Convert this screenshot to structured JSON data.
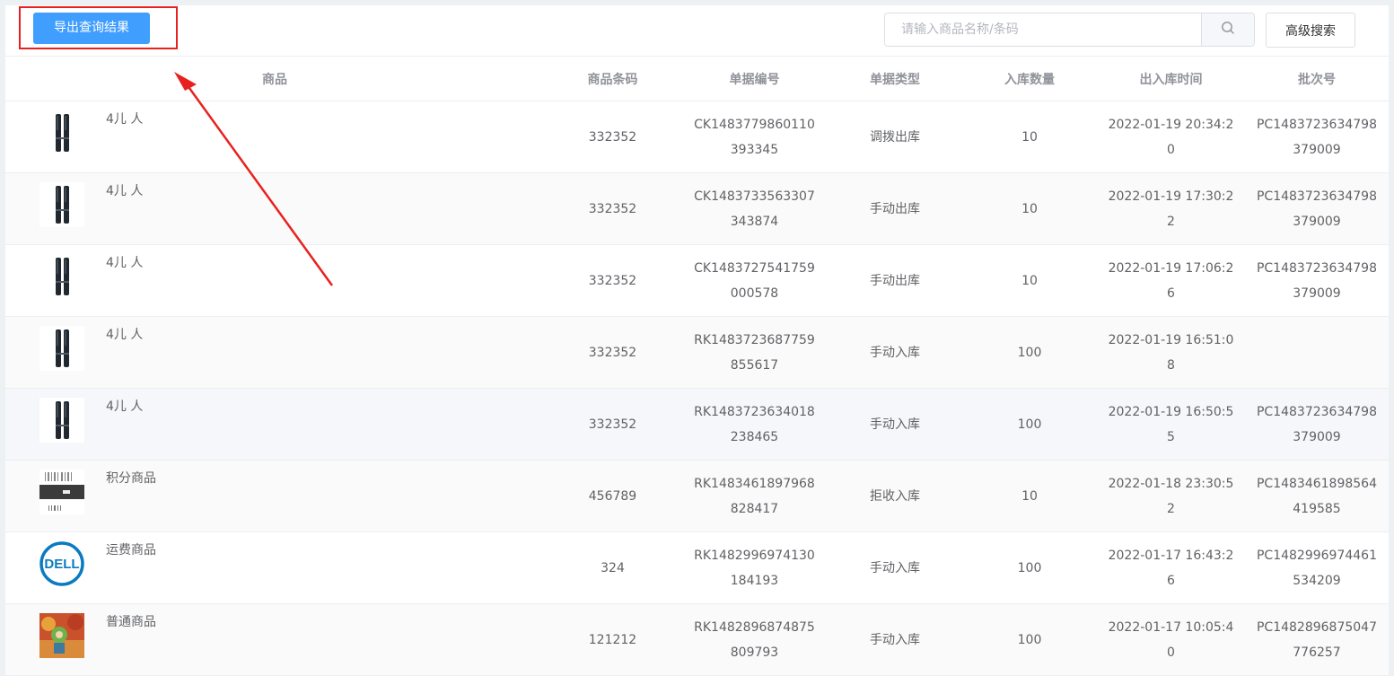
{
  "toolbar": {
    "export_label": "导出查询结果",
    "search_placeholder": "请输入商品名称/条码",
    "search_value": "",
    "advanced_label": "高级搜索"
  },
  "table": {
    "headers": [
      "商品",
      "商品条码",
      "单据编号",
      "单据类型",
      "入库数量",
      "出入库时间",
      "批次号"
    ],
    "rows": [
      {
        "name": "4儿 人",
        "image": "brush-product-icon",
        "barcode": "332352",
        "doc_no": "CK1483779860110393345",
        "doc_type": "调拨出库",
        "qty": "10",
        "time": "2022-01-19 20:34:20",
        "batch": "PC1483723634798379009"
      },
      {
        "name": "4儿 人",
        "image": "brush-product-icon",
        "barcode": "332352",
        "doc_no": "CK1483733563307343874",
        "doc_type": "手动出库",
        "qty": "10",
        "time": "2022-01-19 17:30:22",
        "batch": "PC1483723634798379009"
      },
      {
        "name": "4儿 人",
        "image": "brush-product-icon",
        "barcode": "332352",
        "doc_no": "CK1483727541759000578",
        "doc_type": "手动出库",
        "qty": "10",
        "time": "2022-01-19 17:06:26",
        "batch": "PC1483723634798379009"
      },
      {
        "name": "4儿 人",
        "image": "brush-product-icon",
        "barcode": "332352",
        "doc_no": "RK1483723687759855617",
        "doc_type": "手动入库",
        "qty": "100",
        "time": "2022-01-19 16:51:08",
        "batch": ""
      },
      {
        "name": "4儿 人",
        "image": "brush-product-icon",
        "barcode": "332352",
        "doc_no": "RK1483723634018238465",
        "doc_type": "手动入库",
        "qty": "100",
        "time": "2022-01-19 16:50:55",
        "batch": "PC1483723634798379009"
      },
      {
        "name": "积分商品",
        "image": "barcode-product-icon",
        "barcode": "456789",
        "doc_no": "RK1483461897968828417",
        "doc_type": "拒收入库",
        "qty": "10",
        "time": "2022-01-18 23:30:52",
        "batch": "PC1483461898564419585"
      },
      {
        "name": "运费商品",
        "image": "dell-logo-icon",
        "barcode": "324",
        "doc_no": "RK1482996974130184193",
        "doc_type": "手动入库",
        "qty": "100",
        "time": "2022-01-17 16:43:26",
        "batch": "PC1482996974461534209"
      },
      {
        "name": "普通商品",
        "image": "cartoon-product-icon",
        "barcode": "121212",
        "doc_no": "RK1482896874875809793",
        "doc_type": "手动入库",
        "qty": "100",
        "time": "2022-01-17 10:05:40",
        "batch": "PC1482896875047776257"
      }
    ]
  },
  "colors": {
    "primary": "#409eff",
    "annotation": "#e8211f",
    "border": "#ebeef5",
    "header_text": "#909399"
  }
}
